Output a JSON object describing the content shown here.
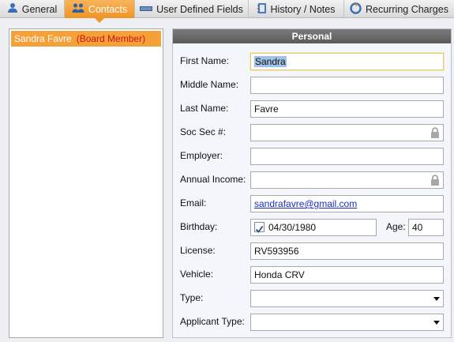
{
  "tabs": [
    {
      "label": "General",
      "icon": "person-icon",
      "active": false
    },
    {
      "label": "Contacts",
      "icon": "contacts-icon",
      "active": true
    },
    {
      "label": "User Defined Fields",
      "icon": "fields-icon",
      "active": false
    },
    {
      "label": "History / Notes",
      "icon": "notebook-icon",
      "active": false
    },
    {
      "label": "Recurring Charges",
      "icon": "recurring-icon",
      "active": false
    }
  ],
  "contacts": [
    {
      "name": "Sandra Favre",
      "role": "(Board Member)"
    }
  ],
  "personal": {
    "header": "Personal",
    "labels": {
      "first_name": "First Name:",
      "middle_name": "Middle Name:",
      "last_name": "Last Name:",
      "ssn": "Soc Sec #:",
      "employer": "Employer:",
      "annual_income": "Annual Income:",
      "email": "Email:",
      "birthday": "Birthday:",
      "age": "Age:",
      "license": "License:",
      "vehicle": "Vehicle:",
      "type": "Type:",
      "applicant_type": "Applicant Type:"
    },
    "values": {
      "first_name": "Sandra",
      "middle_name": "",
      "last_name": "Favre",
      "ssn": "",
      "employer": "",
      "annual_income": "",
      "email": "sandrafavre@gmail.com",
      "birthday": "04/30/1980",
      "birthday_checked": true,
      "age": "40",
      "license": "RV593956",
      "vehicle": "Honda CRV",
      "type": "",
      "applicant_type": ""
    }
  },
  "colors": {
    "active_tab": "#ef9528",
    "selected_item": "#f5a13a",
    "role_text": "#d0121b",
    "panel_header": "#6a6a6a",
    "link": "#1a2fbf"
  }
}
